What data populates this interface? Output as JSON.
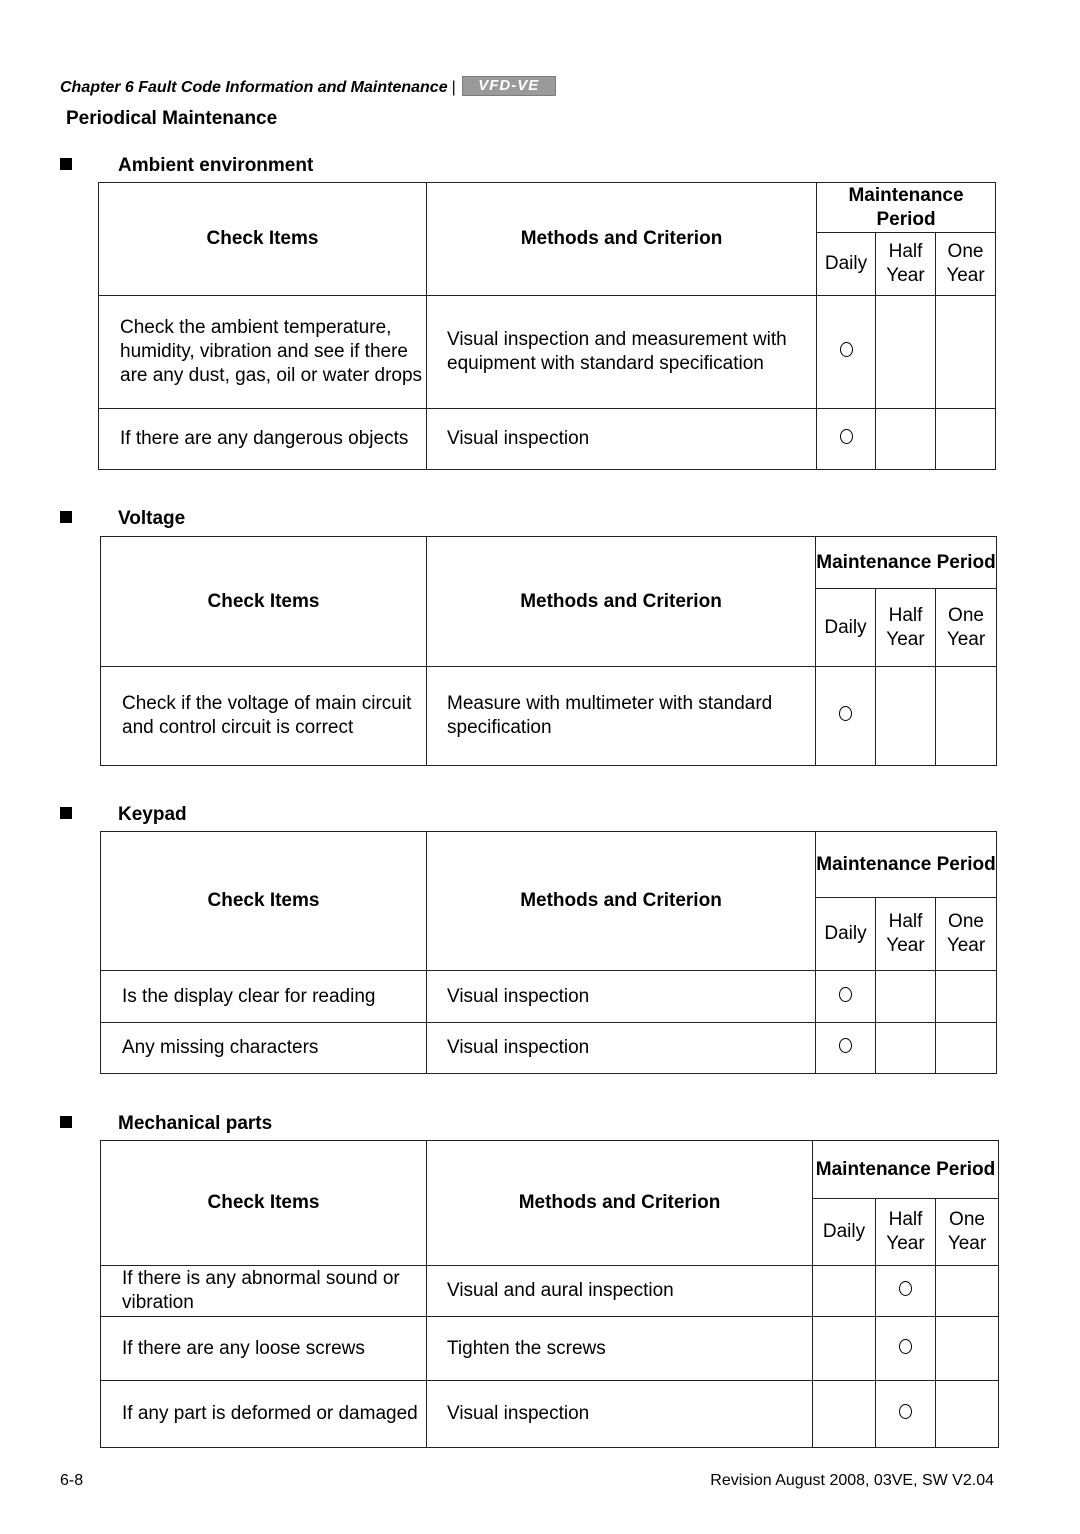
{
  "header": {
    "chapter": "Chapter 6 Fault Code Information and Maintenance",
    "separator": "|",
    "logo_text": "VFD-VE"
  },
  "page_title": "Periodical Maintenance",
  "table_headers": {
    "check_items": "Check Items",
    "methods": "Methods and Criterion",
    "maintenance_period": "Maintenance Period",
    "daily": "Daily",
    "half_year": "Half Year",
    "one_year": "One Year"
  },
  "sections": [
    {
      "title": "Ambient environment",
      "rows": [
        {
          "item": "Check the ambient temperature, humidity, vibration and see if there are any dust, gas, oil or water drops",
          "method": "Visual inspection and measurement with equipment with standard specification",
          "period": "daily",
          "mark": "O"
        },
        {
          "item": "If there are any dangerous objects",
          "method": "Visual inspection",
          "period": "daily",
          "mark": "O"
        }
      ]
    },
    {
      "title": "Voltage",
      "rows": [
        {
          "item": "Check if the voltage of main circuit and control circuit is correct",
          "method": "Measure with multimeter with standard specification",
          "period": "daily",
          "mark": "O"
        }
      ]
    },
    {
      "title": "Keypad",
      "rows": [
        {
          "item": "Is the display clear for reading",
          "method": "Visual inspection",
          "period": "daily",
          "mark": "O"
        },
        {
          "item": "Any missing characters",
          "method": "Visual inspection",
          "period": "daily",
          "mark": "O"
        }
      ]
    },
    {
      "title": "Mechanical parts",
      "rows": [
        {
          "item": "If there is any abnormal sound or vibration",
          "method": "Visual and aural inspection",
          "period": "half_year",
          "mark": "O"
        },
        {
          "item": "If there are any loose screws",
          "method": "Tighten the screws",
          "period": "half_year",
          "mark": "O"
        },
        {
          "item": "If any part is deformed or damaged",
          "method": "Visual inspection",
          "period": "half_year",
          "mark": "O"
        }
      ]
    }
  ],
  "footer": {
    "page_number": "6-8",
    "revision": "Revision August 2008, 03VE, SW V2.04"
  }
}
